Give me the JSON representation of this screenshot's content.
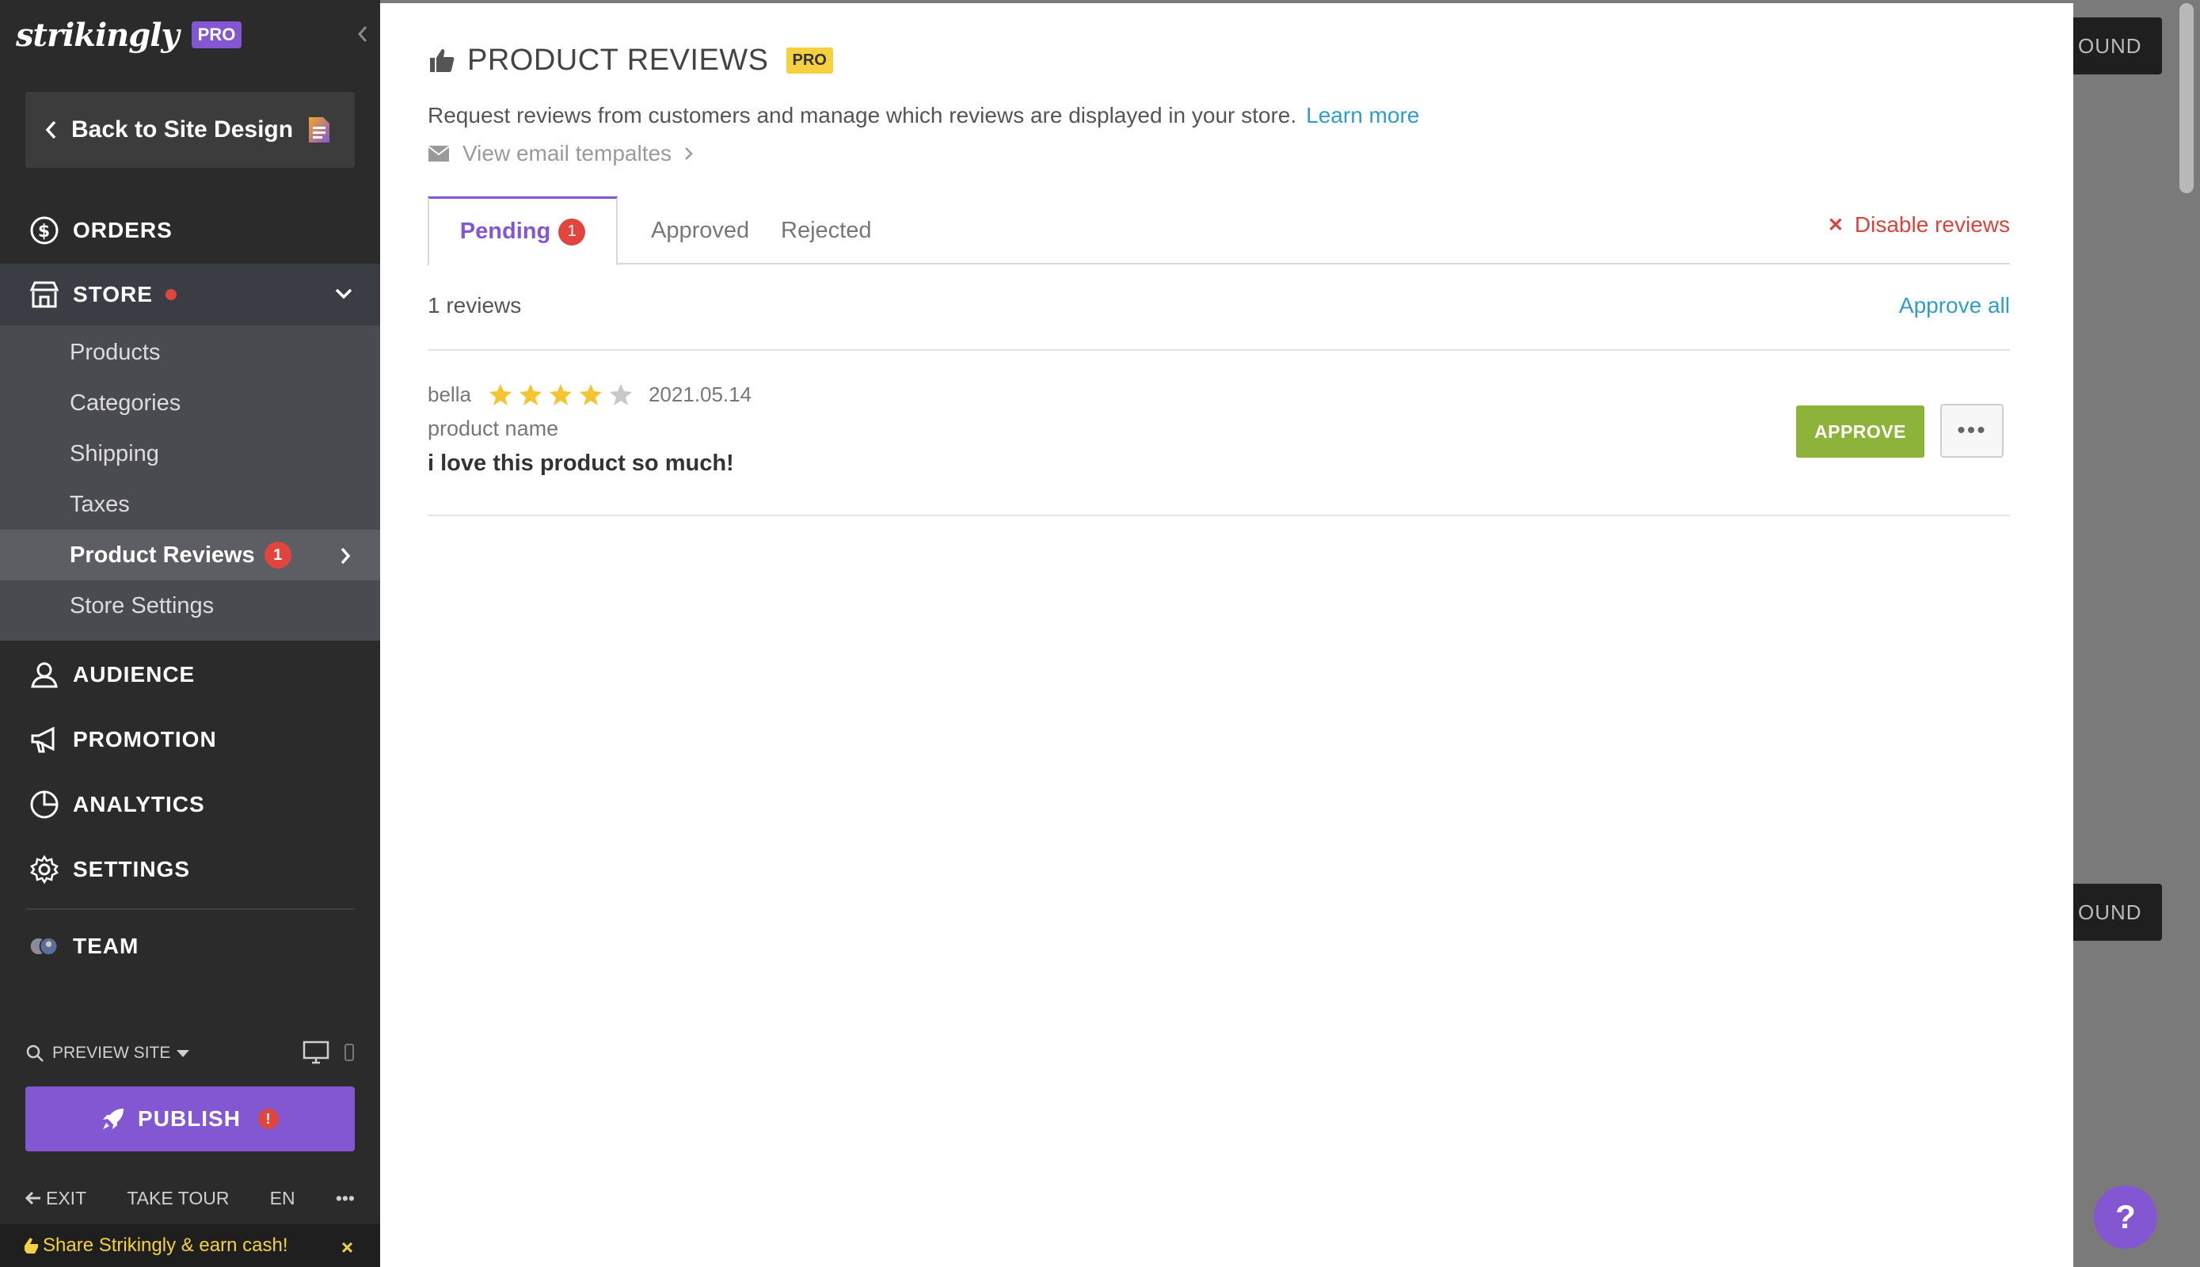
{
  "sidebar": {
    "logo": "strikingly",
    "logo_badge": "PRO",
    "back_label": "Back to Site Design",
    "nav": {
      "orders": "ORDERS",
      "store": "STORE",
      "audience": "AUDIENCE",
      "promotion": "PROMOTION",
      "analytics": "ANALYTICS",
      "settings": "SETTINGS",
      "team": "TEAM"
    },
    "store_items": [
      {
        "label": "Products"
      },
      {
        "label": "Categories"
      },
      {
        "label": "Shipping"
      },
      {
        "label": "Taxes"
      },
      {
        "label": "Product Reviews",
        "badge": "1"
      },
      {
        "label": "Store Settings"
      }
    ],
    "preview_label": "PREVIEW SITE",
    "publish_label": "PUBLISH",
    "publish_alert": "!",
    "bottom": {
      "exit": "EXIT",
      "tour": "TAKE TOUR",
      "lang": "EN",
      "more": "•••"
    },
    "share_text": "Share Strikingly & earn cash!",
    "share_close": "×"
  },
  "main": {
    "title": "PRODUCT REVIEWS",
    "title_badge": "PRO",
    "description": "Request reviews from customers and manage which reviews are displayed in your store.",
    "learn_more": "Learn more",
    "email_link": "View email tempaltes",
    "tabs": [
      {
        "label": "Pending",
        "badge": "1"
      },
      {
        "label": "Approved"
      },
      {
        "label": "Rejected"
      }
    ],
    "disable_label": "Disable reviews",
    "review_count": "1 reviews",
    "approve_all": "Approve all",
    "reviews": [
      {
        "author": "bella",
        "rating": 4,
        "date": "2021.05.14",
        "product": "product name",
        "text": "i love this product so much!",
        "approve_label": "APPROVE",
        "more_label": "•••"
      }
    ]
  },
  "backdrop": {
    "button_text_1": "OUND",
    "button_text_2": "OUND",
    "help": "?"
  },
  "colors": {
    "accent": "#8457d2",
    "danger": "#e0453f",
    "link": "#2f9dc7",
    "approve": "#8db33a",
    "star": "#f5c531"
  }
}
